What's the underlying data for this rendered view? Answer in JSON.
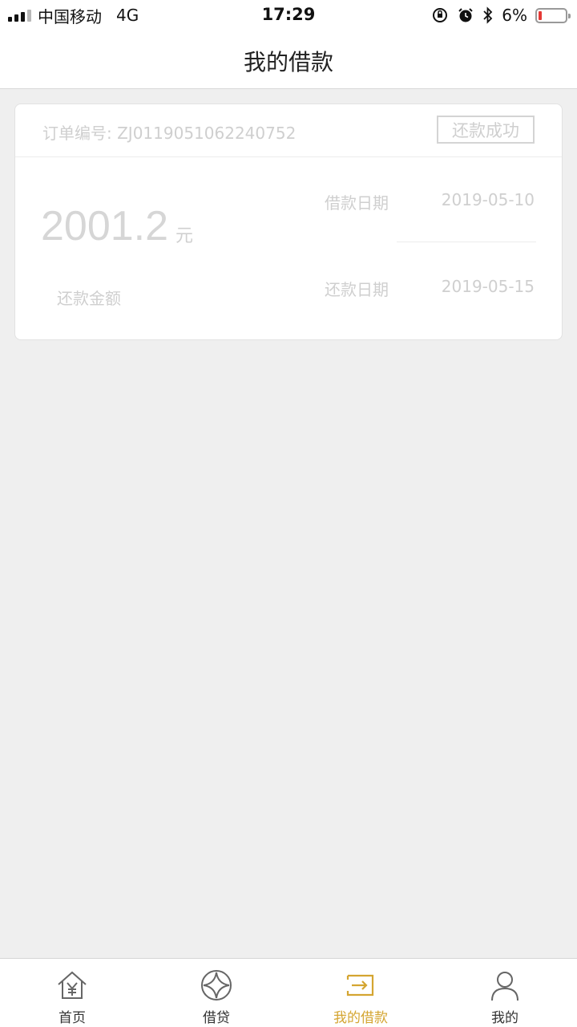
{
  "status_bar": {
    "carrier": "中国移动",
    "network": "4G",
    "time": "17:29",
    "battery": "6%"
  },
  "nav": {
    "title": "我的借款"
  },
  "loan": {
    "order_label": "订单编号: ZJ0119051062240752",
    "status": "还款成功",
    "amount": "2001.2",
    "amount_unit": "元",
    "amount_label": "还款金额",
    "loan_date_label": "借款日期",
    "loan_date": "2019-05-10",
    "repay_date_label": "还款日期",
    "repay_date": "2019-05-15"
  },
  "tabs": [
    {
      "label": "首页",
      "icon": "home-yen-icon",
      "active": false
    },
    {
      "label": "借贷",
      "icon": "diamond-circle-icon",
      "active": false
    },
    {
      "label": "我的借款",
      "icon": "loan-arrow-icon",
      "active": true
    },
    {
      "label": "我的",
      "icon": "user-icon",
      "active": false
    }
  ],
  "colors": {
    "accent": "#d4a531",
    "background": "#efefef",
    "battery_low": "#e53935"
  }
}
